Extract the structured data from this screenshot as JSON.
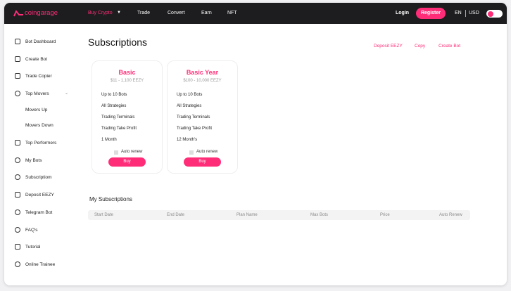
{
  "header": {
    "logo": "coingarage",
    "nav": [
      "Buy Crypto",
      "Trade",
      "Convert",
      "Earn",
      "NFT"
    ],
    "login": "Login",
    "register": "Register",
    "lang": "EN",
    "currency": "USD"
  },
  "sidebar": {
    "items": [
      "Bot Dashboard",
      "Create Bot",
      "Trade Copier",
      "Top Movers",
      "Movers Up",
      "Movers Down",
      "Top Performers",
      "My Bots",
      "Subscriptiom",
      "Deposit EEZY",
      "Telegram Bot",
      "FAQ's",
      "Tutorial",
      "Online Trainee"
    ]
  },
  "main": {
    "title": "Subscriptions",
    "links": [
      "Deposit EEZY",
      "Copy",
      "Create Bot"
    ],
    "plans": [
      {
        "name": "Basic",
        "price": "$11 - 1,100 EEZY",
        "features": [
          "Up to 10 Bots",
          "All Strategies",
          "Trading Terminals",
          "Trading Take Profit",
          "1 Month"
        ],
        "auto_renew": "Auto renew",
        "buy": "Buy"
      },
      {
        "name": "Basic Year",
        "price": "$100 - 10,000 EEZY",
        "features": [
          "Up to 10 Bots",
          "All Strategies",
          "Trading Terminals",
          "Trading Take Profit",
          "12 Month's"
        ],
        "auto_renew": "Auto renew",
        "buy": "Buy"
      }
    ],
    "my_subscriptions": {
      "title": "My Subscriptions",
      "columns": [
        "Start Date",
        "End Date",
        "Plan Name",
        "Max Bots",
        "Price",
        "Auto Renew"
      ]
    }
  }
}
